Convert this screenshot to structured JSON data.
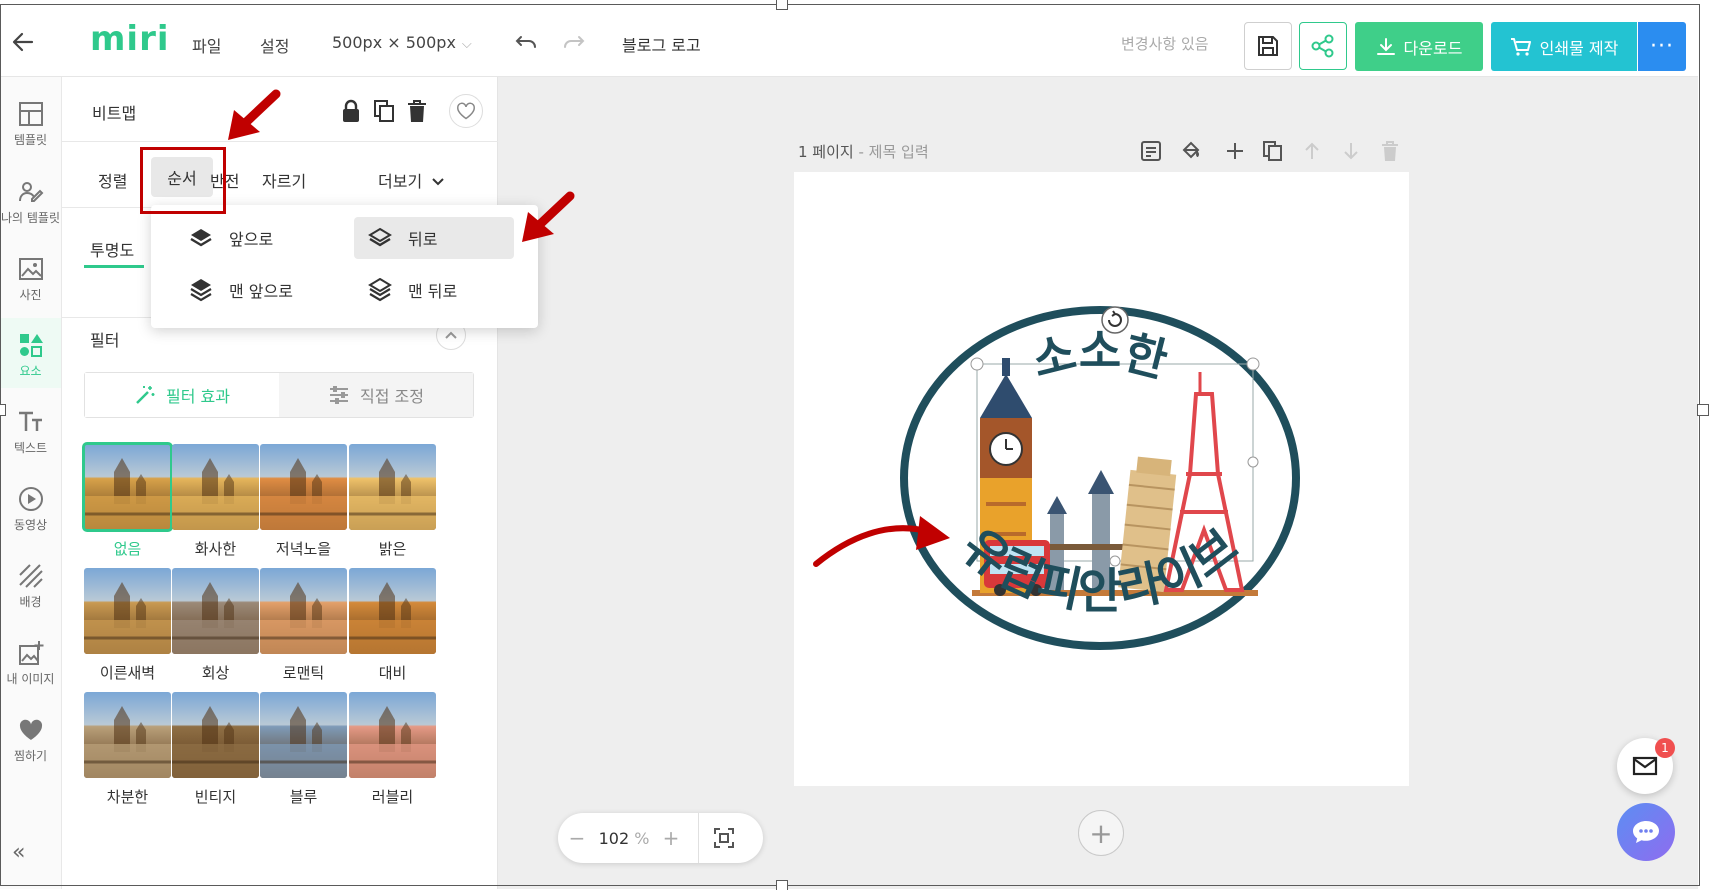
{
  "topbar": {
    "logo": "miri",
    "menu": [
      "파일",
      "설정"
    ],
    "size": "500px × 500px",
    "doc_title": "블로그 로고",
    "status": "변경사항 있음",
    "download_label": "다운로드",
    "print_label": "인쇄물 제작",
    "more_label": "···"
  },
  "rail": {
    "items": [
      {
        "label": "템플릿",
        "icon": "template-icon"
      },
      {
        "label": "나의 템플릿",
        "icon": "my-template-icon"
      },
      {
        "label": "사진",
        "icon": "photo-icon"
      },
      {
        "label": "요소",
        "icon": "elements-icon",
        "active": true
      },
      {
        "label": "텍스트",
        "icon": "text-icon"
      },
      {
        "label": "동영상",
        "icon": "video-icon"
      },
      {
        "label": "배경",
        "icon": "background-icon"
      },
      {
        "label": "내 이미지",
        "icon": "my-image-icon"
      },
      {
        "label": "찜하기",
        "icon": "heart-icon"
      }
    ],
    "collapse": "«"
  },
  "panel": {
    "title": "비트맵",
    "tabs": [
      "정렬",
      "순서",
      "반전",
      "자르기"
    ],
    "more": "더보기",
    "opacity_label": "투명도",
    "filter_title": "필터",
    "filter_tabs": [
      "필터 효과",
      "직접 조정"
    ],
    "filters": [
      "없음",
      "화사한",
      "저녁노을",
      "밝은",
      "이른새벽",
      "회상",
      "로맨틱",
      "대비",
      "차분한",
      "빈티지",
      "블루",
      "러블리"
    ]
  },
  "order_menu": {
    "items": [
      "앞으로",
      "뒤로",
      "맨 앞으로",
      "맨 뒤로"
    ],
    "highlighted": "뒤로"
  },
  "canvas": {
    "page_number": "1 페이지",
    "page_title_placeholder": " - 제목 입력",
    "logo_text_top": "소소한",
    "logo_text_bottom": "유럽피안라이브"
  },
  "zoom": {
    "value": "102",
    "unit": " %"
  },
  "notifications": {
    "mail_count": "1"
  },
  "colors": {
    "brand": "#2fc98c",
    "print": "#23c3d2",
    "more": "#2b8df0",
    "annotation": "#c00000",
    "logo_ring": "#1f4e5c"
  }
}
